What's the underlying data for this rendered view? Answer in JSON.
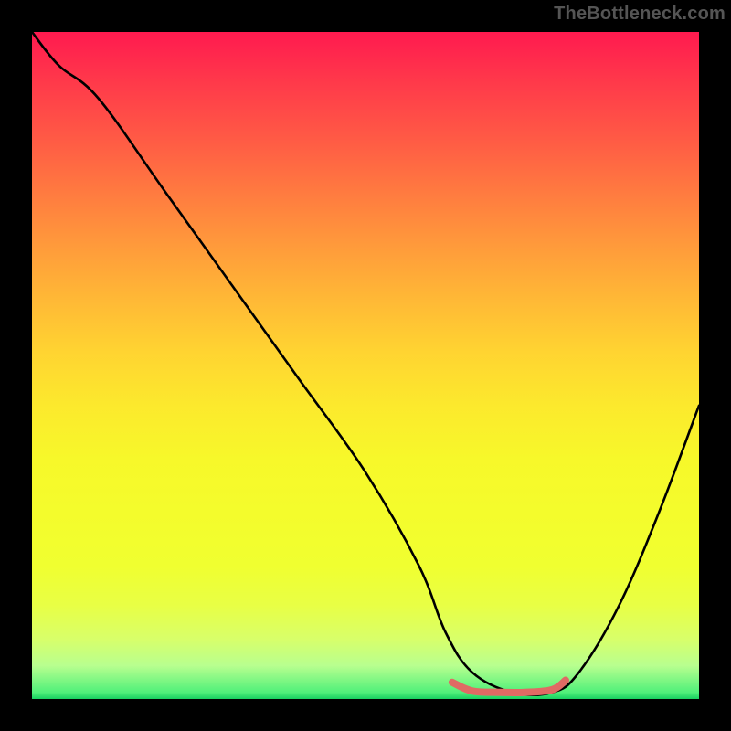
{
  "watermark": "TheBottleneck.com",
  "chart_data": {
    "type": "line",
    "title": "",
    "xlabel": "",
    "ylabel": "",
    "xlim": [
      0,
      100
    ],
    "ylim": [
      0,
      100
    ],
    "grid": false,
    "legend": false,
    "series": [
      {
        "name": "curve",
        "x": [
          0,
          4,
          10,
          20,
          30,
          40,
          50,
          58,
          62,
          66,
          72,
          78,
          82,
          88,
          94,
          100
        ],
        "y": [
          100,
          95,
          90,
          76,
          62,
          48,
          34,
          20,
          10,
          4,
          1,
          1,
          4,
          14,
          28,
          44
        ]
      },
      {
        "name": "highlight",
        "x": [
          63,
          66,
          70,
          74,
          78,
          80
        ],
        "y": [
          2.5,
          1.2,
          1,
          1,
          1.4,
          2.8
        ]
      }
    ],
    "colors": {
      "curve": "#000000",
      "highlight": "#e06a64",
      "gradient_top": "#ff1a4f",
      "gradient_bottom": "#18d060"
    }
  }
}
